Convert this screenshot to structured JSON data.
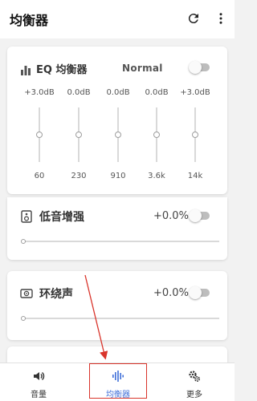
{
  "appbar": {
    "title": "均衡器",
    "refresh_icon": "refresh-icon",
    "more_icon": "more-vert-icon"
  },
  "equalizer": {
    "label": "EQ 均衡器",
    "preset": "Normal",
    "enabled": false,
    "bands": [
      {
        "gain": "+3.0dB",
        "freq": "60",
        "level": 0.5
      },
      {
        "gain": "0.0dB",
        "freq": "230",
        "level": 0.5
      },
      {
        "gain": "0.0dB",
        "freq": "910",
        "level": 0.5
      },
      {
        "gain": "0.0dB",
        "freq": "3.6k",
        "level": 0.5
      },
      {
        "gain": "+3.0dB",
        "freq": "14k",
        "level": 0.5
      }
    ]
  },
  "bass_boost": {
    "label": "低音增强",
    "value": "+0.0%",
    "enabled": false,
    "level": 0
  },
  "surround": {
    "label": "环绕声",
    "value": "+0.0%",
    "enabled": false,
    "level": 0
  },
  "bottom_nav": {
    "items": [
      {
        "label": "音量",
        "icon": "speaker-icon"
      },
      {
        "label": "均衡器",
        "icon": "waveform-icon"
      },
      {
        "label": "更多",
        "icon": "gears-icon"
      }
    ],
    "active_index": 1
  },
  "colors": {
    "accent": "#3f6fd8",
    "annotation": "#d9342b"
  }
}
